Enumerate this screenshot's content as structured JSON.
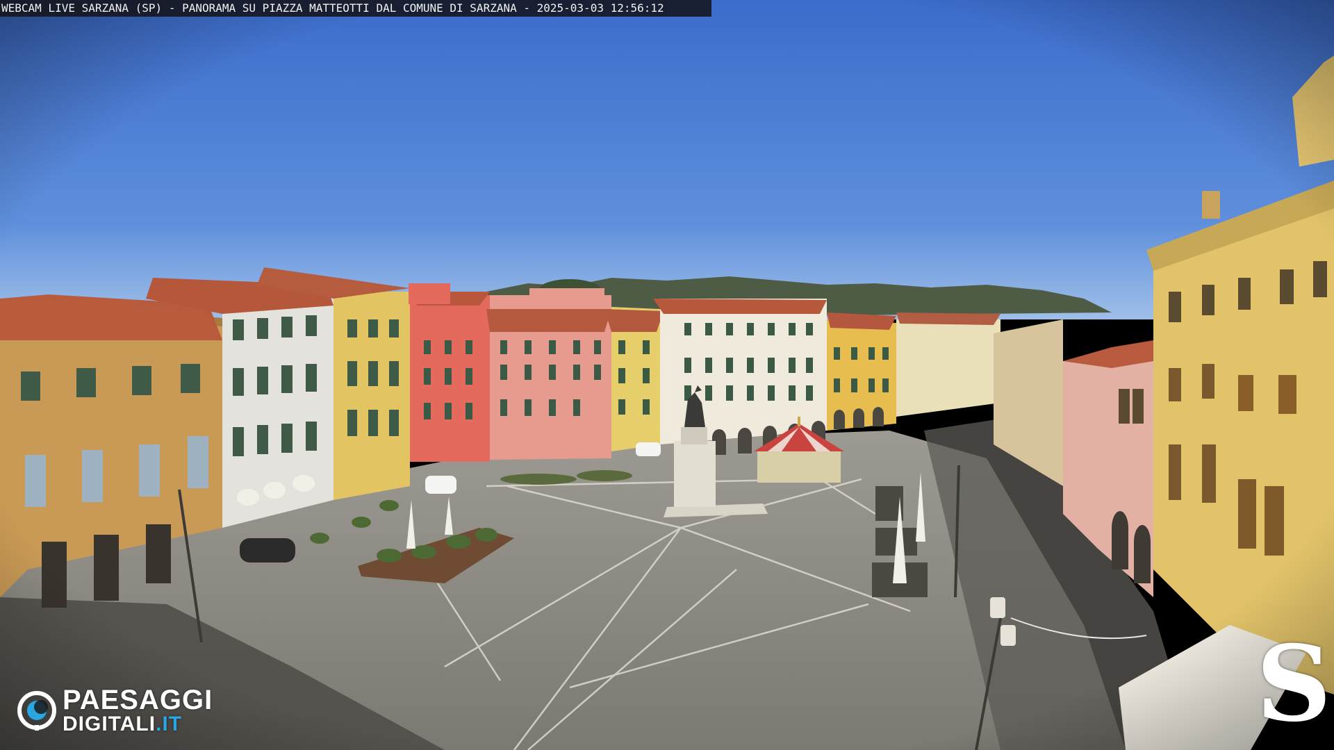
{
  "overlay": {
    "caption": "WEBCAM LIVE SARZANA (SP) - PANORAMA SU PIAZZA MATTEOTTI DAL COMUNE DI SARZANA - 2025-03-03  12:56:12",
    "logo_left": {
      "line1": "PAESAGGI",
      "line2_main": "DIGITALI",
      "line2_suffix": ".IT",
      "accent": "#2aa6e0"
    },
    "logo_right": {
      "glyph": "S"
    }
  },
  "palette": {
    "sky_top": "#3a6fcf",
    "sky_horizon": "#8fb4e6",
    "hills": "#4e5a44",
    "pavement": "#8a8880",
    "roof": "#b5573a",
    "ochre": "#c99a4f",
    "pink": "#e08a84",
    "salmon": "#e2685a",
    "cream": "#ece5d4",
    "yellow": "#e2c05c"
  }
}
